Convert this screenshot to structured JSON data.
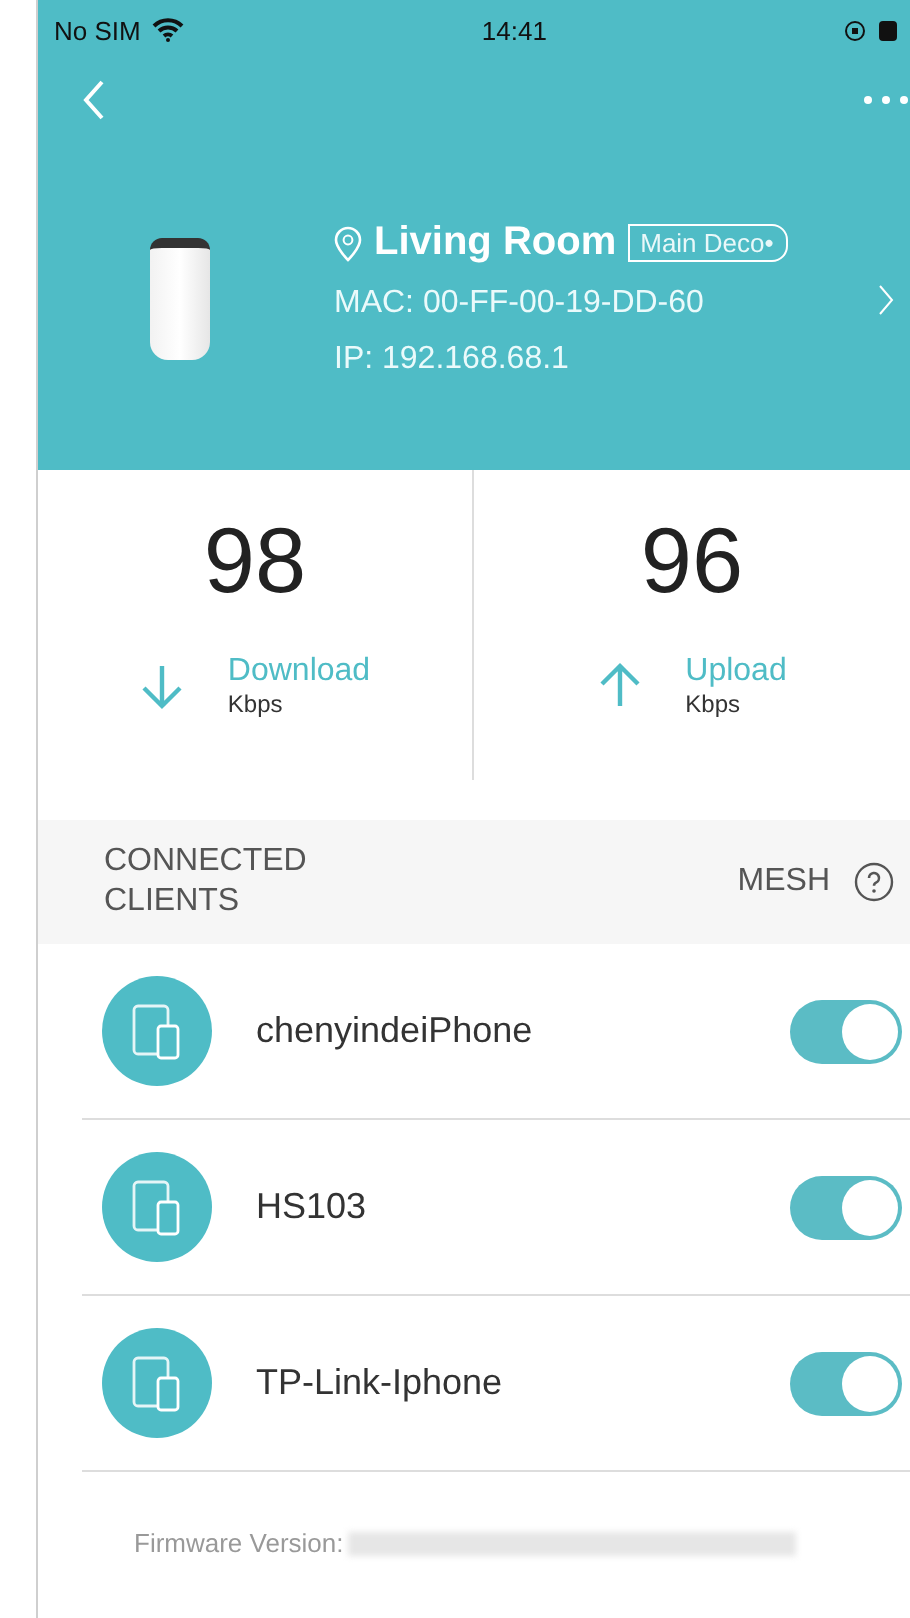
{
  "status_bar": {
    "carrier": "No SIM",
    "time": "14:41"
  },
  "device": {
    "location": "Living Room",
    "badge": "Main Deco•",
    "mac": "MAC: 00-FF-00-19-DD-60",
    "ip": "IP: 192.168.68.1"
  },
  "stats": [
    {
      "value": "98",
      "label": "Download",
      "unit": "Kbps",
      "kind": "down"
    },
    {
      "value": "96",
      "label": "Upload",
      "unit": "Kbps",
      "kind": "up"
    }
  ],
  "section": {
    "title": "CONNECTED CLIENTS",
    "mesh_label": "MESH"
  },
  "clients": [
    {
      "name": "chenyindeiPhone",
      "on": true
    },
    {
      "name": "HS103",
      "on": true
    },
    {
      "name": "TP-Link-Iphone",
      "on": true
    }
  ],
  "footer": {
    "firmware_label": "Firmware Version:"
  }
}
